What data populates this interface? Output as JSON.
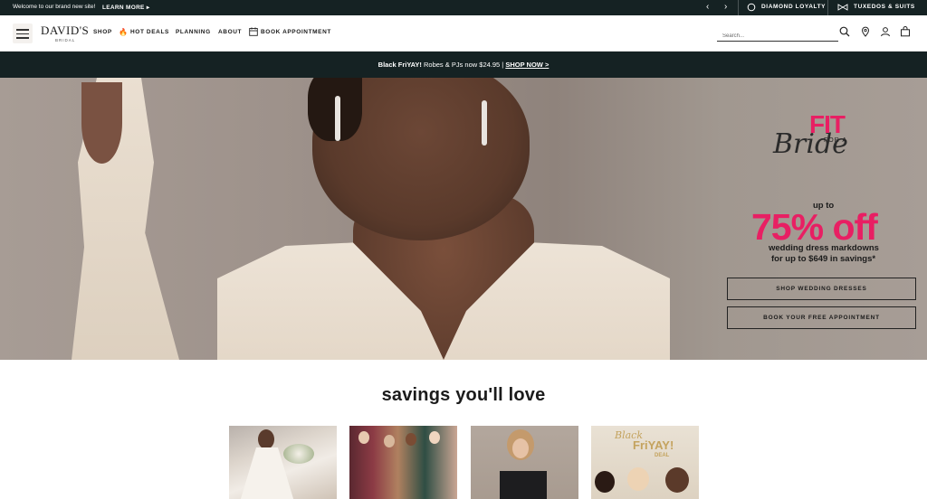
{
  "topbar": {
    "welcome": "Welcome to our brand new site!",
    "learn_more": "LEARN MORE",
    "prev_icon": "chevron-left-icon",
    "next_icon": "chevron-right-icon",
    "diamond_loyalty": "DIAMOND LOYALTY",
    "tuxedos": "TUXEDOS & SUITS"
  },
  "nav": {
    "logo": "DAVID'S",
    "logo_sub": "BRIDAL",
    "links": [
      "SHOP",
      "HOT DEALS",
      "PLANNING",
      "ABOUT",
      "BOOK APPOINTMENT"
    ],
    "search_placeholder": "Search..."
  },
  "banner": {
    "strong": "Black FriYAY!",
    "text": " Robes & PJs now $24.95  |  ",
    "cta": "SHOP NOW >"
  },
  "hero": {
    "fit": "FIT",
    "for_a": "FOR A",
    "bride": "Bride",
    "up_to": "up to",
    "percent": "75% off",
    "sub1": "wedding dress markdowns",
    "sub2": "for up to $649 in savings*",
    "btn1": "SHOP WEDDING DRESSES",
    "btn2": "BOOK YOUR FREE APPOINTMENT"
  },
  "savings": {
    "title": "savings you'll love",
    "tile4_line1": "Black",
    "tile4_line2": "FriYAY!",
    "tile4_line3": "DEAL"
  },
  "colors": {
    "dark_teal": "#152223",
    "accent_pink": "#e81f63"
  }
}
